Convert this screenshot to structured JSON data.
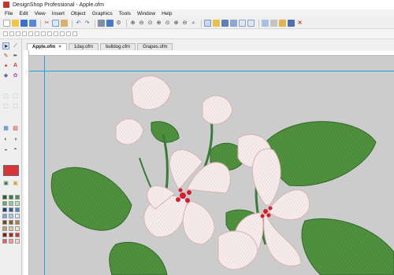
{
  "window": {
    "title": "DesignShop Professional - Apple.ofm"
  },
  "menubar": {
    "items": [
      "File",
      "Edit",
      "View",
      "Insert",
      "Object",
      "Graphics",
      "Tools",
      "Window",
      "Help"
    ]
  },
  "toolbar": {
    "icons": [
      "new-icon",
      "open-icon",
      "save-icon",
      "save-as-icon",
      "cut-icon",
      "copy-icon",
      "paste-icon",
      "undo-icon",
      "redo-icon",
      "print-icon",
      "print-preview-icon",
      "settings-icon",
      "zoom-in-icon",
      "zoom-out-icon",
      "zoom-fit-icon",
      "zoom-page-icon",
      "zoom-selection-icon",
      "zoom-100-icon",
      "zoom-grid-icon",
      "zoom-icon",
      "stitch-view-icon",
      "fill-view-icon",
      "outline-view-icon",
      "realistic-view-icon",
      "grid-icon",
      "hoop-icon",
      "close-view-icon"
    ]
  },
  "tabs": [
    {
      "label": "Apple.ofm",
      "active": true
    },
    {
      "label": "1day.ofm",
      "active": false
    },
    {
      "label": "bulldog.ofm",
      "active": false
    },
    {
      "label": "Grapes.ofm",
      "active": false
    }
  ],
  "tabs_close_symbol": "×",
  "left_toolbar": {
    "icons": [
      "select-arrow-icon",
      "line-tool-icon",
      "node-edit-icon",
      "pen-tool-icon",
      "magic-wand-icon",
      "text-tool-icon",
      "shape-tool-icon",
      "fill-tool-icon",
      "transform-icon",
      "rotate-icon",
      "mirror-icon",
      "align-icon",
      "stitch-icon",
      "density-icon",
      "color-picker-icon"
    ],
    "active_color": "#d9343a",
    "palette": [
      "#2a5f2a",
      "#3a7a3a",
      "#4a944a",
      "#66aa66",
      "#8ecf8e",
      "#b8e2b8",
      "#1d3f6b",
      "#2e5f9a",
      "#4a84c6",
      "#78a9db",
      "#a9c8e9",
      "#dce8f5",
      "#6b4a2a",
      "#8a6238",
      "#a8804a",
      "#c7a06a",
      "#e3c59a",
      "#f4e2c6",
      "#7a1f1f",
      "#a32a2a",
      "#c93a3a",
      "#e06060",
      "#f29a9a",
      "#f9cfcf"
    ]
  },
  "canvas": {
    "background": "#cccccc",
    "guide_color": "#2a9fd6",
    "leaf_color": "#4a8a3a",
    "leaf_dark": "#2f6a2a",
    "petal_color": "#f2e4e4",
    "petal_shade": "#e6c4c4",
    "stamen_color": "#d02030"
  }
}
